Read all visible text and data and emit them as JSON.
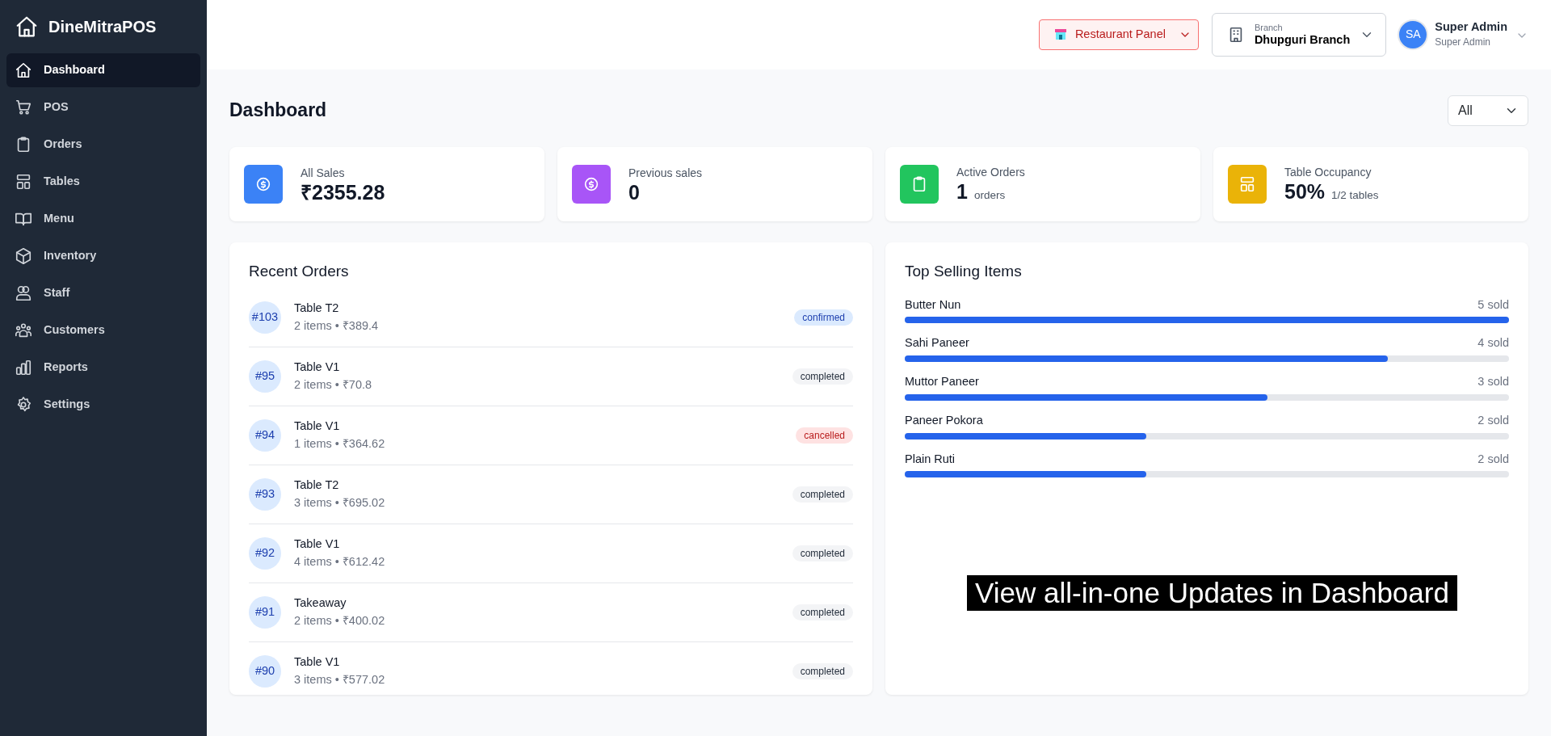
{
  "brand": {
    "name": "DineMitraPOS"
  },
  "sidebar": {
    "items": [
      {
        "label": "Dashboard",
        "selected": true
      },
      {
        "label": "POS",
        "selected": false
      },
      {
        "label": "Orders",
        "selected": false
      },
      {
        "label": "Tables",
        "selected": false
      },
      {
        "label": "Menu",
        "selected": false
      },
      {
        "label": "Inventory",
        "selected": false
      },
      {
        "label": "Staff",
        "selected": false
      },
      {
        "label": "Customers",
        "selected": false
      },
      {
        "label": "Reports",
        "selected": false
      },
      {
        "label": "Settings",
        "selected": false
      }
    ]
  },
  "header": {
    "panel_select": {
      "value": "Restaurant Panel"
    },
    "branch": {
      "label": "Branch",
      "value": "Dhupguri Branch"
    },
    "user": {
      "initials": "SA",
      "name": "Super Admin",
      "role": "Super Admin"
    }
  },
  "page": {
    "title": "Dashboard",
    "filter": {
      "value": "All"
    }
  },
  "stats": [
    {
      "label": "All Sales",
      "value": "₹2355.28",
      "color": "#3b82f6"
    },
    {
      "label": "Previous sales",
      "value": "0",
      "color": "#a855f7"
    },
    {
      "label": "Active Orders",
      "value": "1",
      "unit": "orders",
      "color": "#22c55e"
    },
    {
      "label": "Table Occupancy",
      "value": "50%",
      "unit": "1/2 tables",
      "color": "#eab308"
    }
  ],
  "recent_orders": {
    "title": "Recent Orders",
    "rows": [
      {
        "number": "#103",
        "table": "Table T2",
        "details": "2 items • ₹389.4",
        "status": "confirmed",
        "kind": "info"
      },
      {
        "number": "#95",
        "table": "Table V1",
        "details": "2 items • ₹70.8",
        "status": "completed",
        "kind": "neutral"
      },
      {
        "number": "#94",
        "table": "Table V1",
        "details": "1 items • ₹364.62",
        "status": "cancelled",
        "kind": "danger"
      },
      {
        "number": "#93",
        "table": "Table T2",
        "details": "3 items • ₹695.02",
        "status": "completed",
        "kind": "neutral"
      },
      {
        "number": "#92",
        "table": "Table V1",
        "details": "4 items • ₹612.42",
        "status": "completed",
        "kind": "neutral"
      },
      {
        "number": "#91",
        "table": "Takeaway",
        "details": "2 items • ₹400.02",
        "status": "completed",
        "kind": "neutral"
      },
      {
        "number": "#90",
        "table": "Table V1",
        "details": "3 items • ₹577.02",
        "status": "completed",
        "kind": "neutral"
      }
    ]
  },
  "top_selling": {
    "title": "Top Selling Items",
    "items": [
      {
        "name": "Butter Nun",
        "sold": "5 sold",
        "level": 1
      },
      {
        "name": "Sahi Paneer",
        "sold": "4 sold",
        "level": 0.8
      },
      {
        "name": "Muttor Paneer",
        "sold": "3 sold",
        "level": 0.6
      },
      {
        "name": "Paneer Pokora",
        "sold": "2 sold",
        "level": 0.4
      },
      {
        "name": "Plain Ruti",
        "sold": "2 sold",
        "level": 0.4
      }
    ]
  },
  "caption": "View all-in-one Updates in Dashboard"
}
